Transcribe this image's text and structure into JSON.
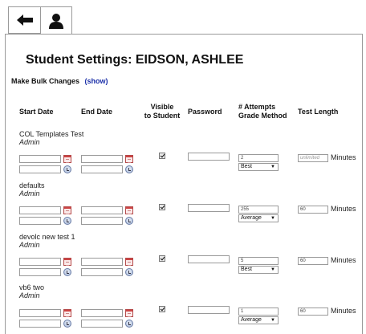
{
  "tabs": [
    {
      "icon": "back-arrow-icon"
    },
    {
      "icon": "user-icon"
    }
  ],
  "title": "Student Settings: EIDSON, ASHLEE",
  "bulk": {
    "label": "Make Bulk Changes",
    "link": "(show)"
  },
  "columns": {
    "start_date": "Start Date",
    "end_date": "End Date",
    "visible_line1": "Visible",
    "visible_line2": "to Student",
    "password": "Password",
    "attempts_line1": "# Attempts",
    "attempts_line2": "Grade Method",
    "test_length": "Test Length"
  },
  "rows": [
    {
      "name": "COL Templates Test",
      "role": "Admin",
      "attempts": "2",
      "grade_method": "Best",
      "test_length": "unlimited",
      "unit": "Minutes",
      "visible": true
    },
    {
      "name": "defaults",
      "role": "Admin",
      "attempts": "255",
      "grade_method": "Average",
      "test_length": "60",
      "unit": "Minutes",
      "visible": true
    },
    {
      "name": "devolc new test 1",
      "role": "Admin",
      "attempts": "5",
      "grade_method": "Best",
      "test_length": "60",
      "unit": "Minutes",
      "visible": true
    },
    {
      "name": "vb6 two",
      "role": "Admin",
      "attempts": "1",
      "grade_method": "Average",
      "test_length": "60",
      "unit": "Minutes",
      "visible": true
    }
  ]
}
